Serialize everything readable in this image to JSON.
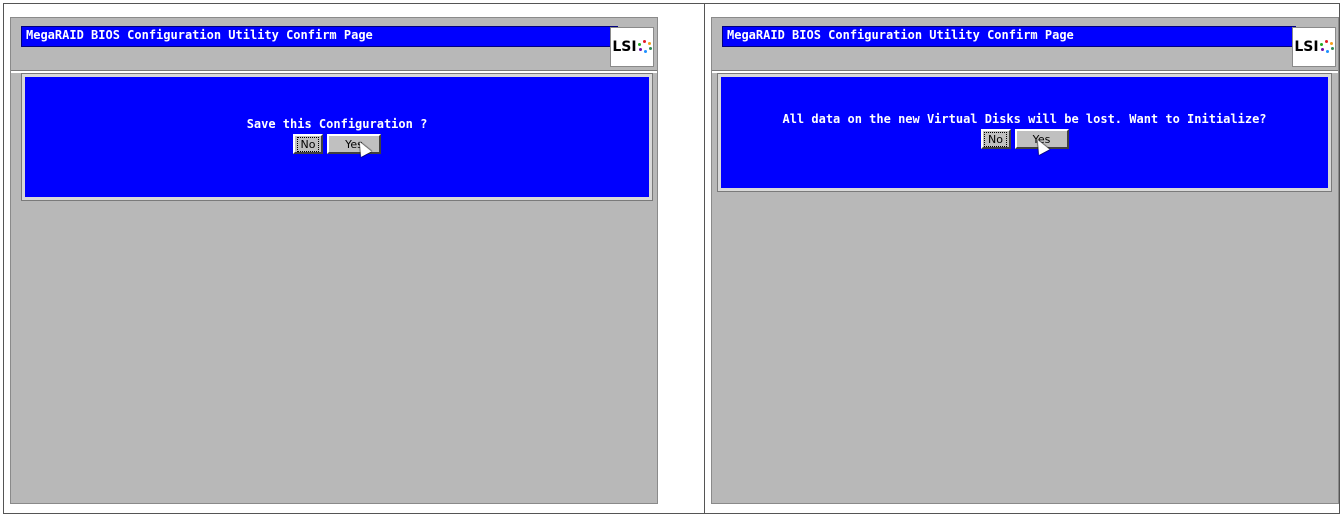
{
  "panels": [
    {
      "title": "MegaRAID BIOS Configuration Utility Confirm Page",
      "logo_text": "LSI",
      "message": "Save this Configuration ?",
      "buttons": {
        "no": "No",
        "yes": "Yes"
      }
    },
    {
      "title": "MegaRAID BIOS Configuration Utility Confirm Page",
      "logo_text": "LSI",
      "message": "All data on the new Virtual Disks will be lost. Want to Initialize?",
      "buttons": {
        "no": "No",
        "yes": "Yes"
      }
    }
  ],
  "colors": {
    "dialog_blue": "#0000ff",
    "background_gray": "#b8b8b8"
  }
}
